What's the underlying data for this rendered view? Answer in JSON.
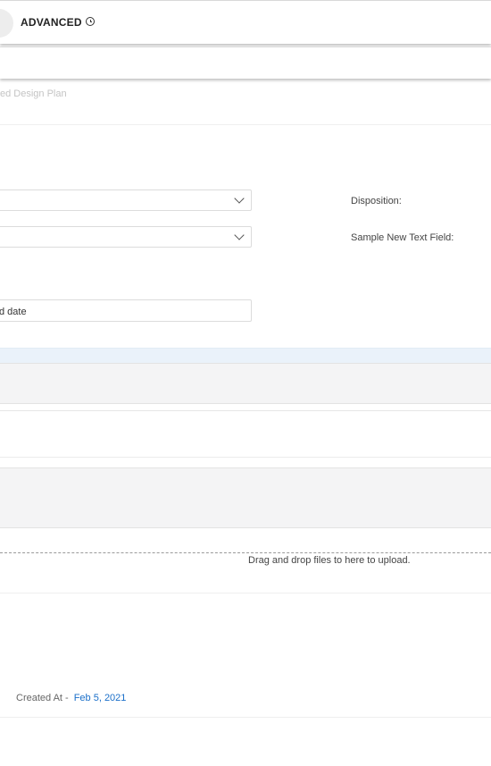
{
  "header": {
    "mode_label": "ADVANCED",
    "history_icon": "clock-icon"
  },
  "breadcrumb": {
    "text": "ed Design Plan"
  },
  "form": {
    "select_1": {
      "value": ""
    },
    "select_2": {
      "value": ""
    },
    "disposition_label": "Disposition:",
    "sample_text_field_label": "Sample New Text Field:",
    "date_field_text": "d date"
  },
  "attachments": {
    "dropzone_text": "Drag and drop files to here to upload."
  },
  "footer": {
    "created_label": "Created At -",
    "created_date": "Feb 5, 2021"
  },
  "colors": {
    "link": "#1a6fc9",
    "strip": "#eaf2fa",
    "panel_gray": "#f4f4f5"
  }
}
